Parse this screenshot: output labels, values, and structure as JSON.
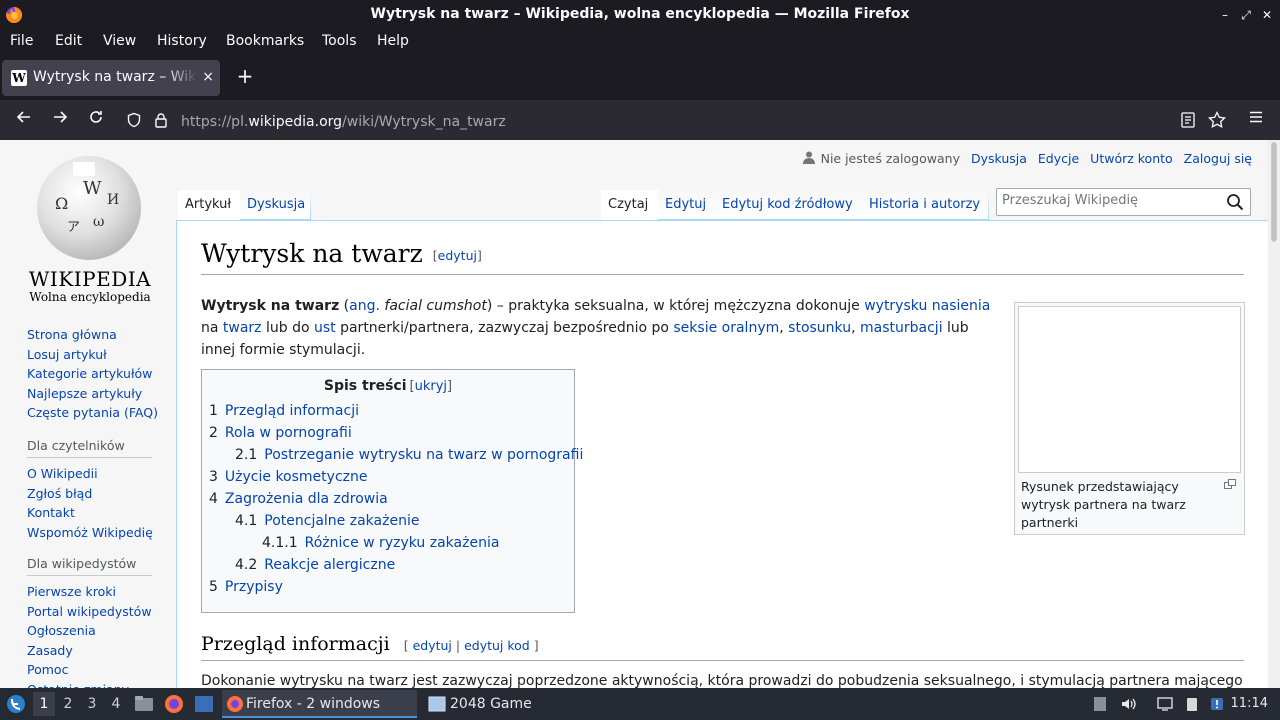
{
  "window": {
    "title": "Wytrysk na twarz – Wikipedia, wolna encyklopedia — Mozilla Firefox",
    "controls": [
      "–",
      "⤢",
      "✕"
    ]
  },
  "menu": [
    "File",
    "Edit",
    "View",
    "History",
    "Bookmarks",
    "Tools",
    "Help"
  ],
  "tab": {
    "title": "Wytrysk na twarz – Wikipedia, wolna encyklopedia",
    "close": "×",
    "new_tab": "+"
  },
  "url": {
    "prefix": "https://pl.",
    "host": "wikipedia.org",
    "path": "/wiki/Wytrysk_na_twarz"
  },
  "wiki": {
    "logo": {
      "wordmark": "WIKIPEDIA",
      "tagline": "Wolna encyklopedia"
    },
    "usertools": {
      "anon": "Nie jesteś zalogowany",
      "talk": "Dyskusja",
      "contribs": "Edycje",
      "create": "Utwórz konto",
      "login": "Zaloguj się"
    },
    "nav_main": [
      "Strona główna",
      "Losuj artykuł",
      "Kategorie artykułów",
      "Najlepsze artykuły",
      "Częste pytania (FAQ)"
    ],
    "readers": {
      "heading": "Dla czytelników",
      "items": [
        "O Wikipedii",
        "Zgłoś błąd",
        "Kontakt",
        "Wspomóż Wikipedię"
      ]
    },
    "editors": {
      "heading": "Dla wikipedystów",
      "items": [
        "Pierwsze kroki",
        "Portal wikipedystów",
        "Ogłoszenia",
        "Zasady",
        "Pomoc",
        "Ostatnie zmiany"
      ]
    },
    "tabs_left": {
      "article": "Artykuł",
      "talk": "Dyskusja"
    },
    "tabs_right": {
      "read": "Czytaj",
      "edit": "Edytuj",
      "edit_source": "Edytuj kod źródłowy",
      "history": "Historia i autorzy"
    },
    "search_placeholder": "Przeszukaj Wikipedię",
    "heading": "Wytrysk na twarz",
    "heading_edit": "edytuj",
    "lead": {
      "bold": "Wytrysk na twarz",
      "t1": " (",
      "ang": "ang.",
      "t2": " ",
      "en": "facial cumshot",
      "t3": ") – praktyka seksualna, w której mężczyzna dokonuje ",
      "l1": "wytrysku nasienia",
      "t4": " na ",
      "l2": "twarz",
      "t5": " lub do ",
      "l3": "ust",
      "t6": " partnerki/partnera, zazwyczaj bezpośrednio po ",
      "l4": "seksie oralnym",
      "t7": ", ",
      "l5": "stosunku",
      "t8": ", ",
      "l6": "masturbacji",
      "t9": " lub innej formie stymulacji."
    },
    "thumb_caption": "Rysunek przedstawiający wytrysk partnera na twarz partnerki",
    "toc": {
      "title": "Spis treści",
      "toggle": "ukryj",
      "items": [
        {
          "num": "1",
          "text": "Przegląd informacji"
        },
        {
          "num": "2",
          "text": "Rola w pornografii"
        },
        {
          "num": "2.1",
          "text": "Postrzeganie wytrysku na twarz w pornografii"
        },
        {
          "num": "3",
          "text": "Użycie kosmetyczne"
        },
        {
          "num": "4",
          "text": "Zagrożenia dla zdrowia"
        },
        {
          "num": "4.1",
          "text": "Potencjalne zakażenie"
        },
        {
          "num": "4.1.1",
          "text": "Różnice w ryzyku zakażenia"
        },
        {
          "num": "4.2",
          "text": "Reakcje alergiczne"
        },
        {
          "num": "5",
          "text": "Przypisy"
        }
      ]
    },
    "section": {
      "title": "Przegląd informacji",
      "edit": "edytuj",
      "edit_source": "edytuj kod"
    },
    "para2": "Dokonanie wytrysku na twarz jest zazwyczaj poprzedzone aktywnością, która prowadzi do pobudzenia seksualnego, i stymulacją partnera mającego"
  },
  "taskbar": {
    "workspaces": [
      "1",
      "2",
      "3",
      "4"
    ],
    "tasks": {
      "firefox": "Firefox - 2 windows",
      "game": "2048 Game"
    },
    "clock": "11:14"
  }
}
